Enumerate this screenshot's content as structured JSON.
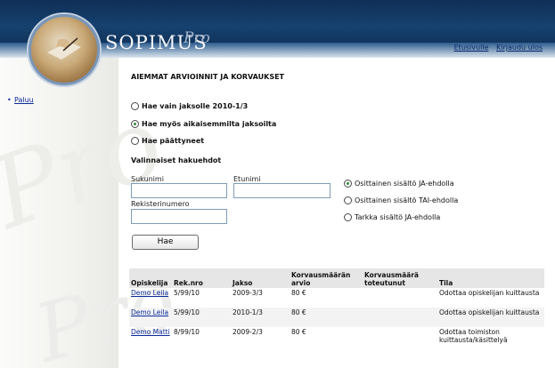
{
  "header": {
    "brand": "SOPIMUS",
    "brand_suffix": "Pro",
    "links": [
      "Etusivulle",
      "Kirjaudu ulos"
    ]
  },
  "sidebar": {
    "back_link": "Paluu"
  },
  "page": {
    "title": "AIEMMAT ARVIOINNIT JA KORVAUKSET",
    "period_options": [
      {
        "label": "Hae vain jaksolle 2010-1/3",
        "selected": false
      },
      {
        "label": "Hae myös aikaisemmilta jaksoilta",
        "selected": true
      },
      {
        "label": "Hae päättyneet",
        "selected": false
      }
    ],
    "optional_criteria_label": "Valinnaiset hakuehdot",
    "fields": {
      "surname_label": "Sukunimi",
      "surname_value": "",
      "firstname_label": "Etunimi",
      "firstname_value": "",
      "regnum_label": "Rekisterinumero",
      "regnum_value": ""
    },
    "match_options": [
      {
        "label": "Osittainen sisältö JA-ehdolla",
        "selected": true
      },
      {
        "label": "Osittainen sisältö TAI-ehdolla",
        "selected": false
      },
      {
        "label": "Tarkka sisältö JA-ehdolla",
        "selected": false
      }
    ],
    "search_button": "Hae"
  },
  "table": {
    "columns": [
      "Opiskelija",
      "Rek.nro",
      "Jakso",
      "Korvausmäärän arvio",
      "Korvausmäärä toteutunut",
      "Tila"
    ],
    "rows": [
      {
        "student": "Demo Leila",
        "regnum": "5/99/10",
        "period": "2009-3/3",
        "estimate": "80 €",
        "actual": "",
        "status": "Odottaa opiskelijan kuittausta"
      },
      {
        "student": "Demo Leila",
        "regnum": "5/99/10",
        "period": "2010-1/3",
        "estimate": "80 €",
        "actual": "",
        "status": "Odottaa opiskelijan kuittausta"
      },
      {
        "student": "Demo Matti",
        "regnum": "8/99/10",
        "period": "2009-2/3",
        "estimate": "80 €",
        "actual": "",
        "status": "Odottaa toimiston kuittausta/käsittelyä"
      }
    ]
  }
}
